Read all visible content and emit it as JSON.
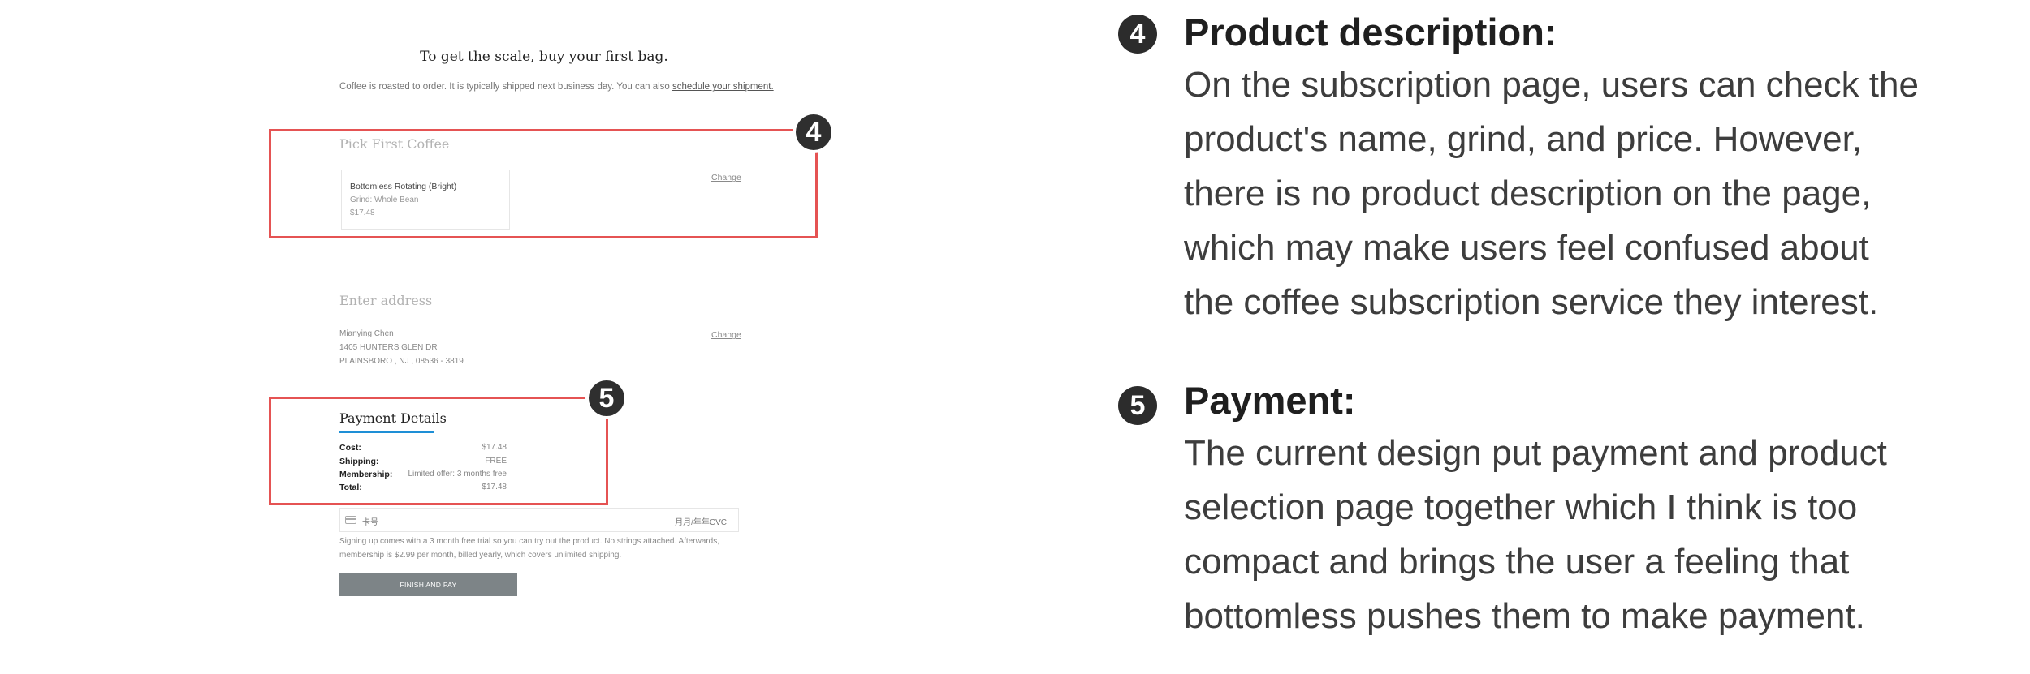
{
  "mockup": {
    "headline": "To get the scale, buy your first bag.",
    "subline_text": "Coffee is roasted to order. It is typically shipped next business day. You can also ",
    "subline_link": "schedule your shipment.",
    "pick_section": {
      "title": "Pick First Coffee",
      "change_label": "Change",
      "product_name": "Bottomless Rotating (Bright)",
      "product_grind": "Grind: Whole Bean",
      "product_price": "$17.48"
    },
    "address_section": {
      "title": "Enter address",
      "change_label": "Change",
      "lines": [
        "Mianying Chen",
        "1405 HUNTERS GLEN DR",
        "PLAINSBORO , NJ , 08536 - 3819"
      ]
    },
    "payment": {
      "title": "Payment Details",
      "rows": [
        {
          "label": "Cost:",
          "value": "$17.48"
        },
        {
          "label": "Shipping:",
          "value": "FREE"
        },
        {
          "label": "Membership:",
          "value": "Limited offer: 3 months free"
        },
        {
          "label": "Total:",
          "value": "$17.48"
        }
      ],
      "card_number_placeholder": "卡号",
      "card_expiry_placeholder": "月月/年年CVC",
      "fine_print": "Signing up comes with a 3 month free trial so you can try out the product. No strings attached. Afterwards, membership is $2.99 per month, billed yearly, which covers unlimited shipping.",
      "finish_button": "FINISH AND PAY"
    },
    "markers": {
      "four": "4",
      "five": "5"
    },
    "highlight_color": "#e55353",
    "accent_color": "#1e8fd6"
  },
  "notes": [
    {
      "number": "4",
      "title": "Product description:",
      "lines": [
        "On the subscription page, users can check the",
        "product's name, grind, and price. However,",
        "there is no product description on the page,",
        "which may make users feel confused about",
        "the coffee subscription service they interest."
      ]
    },
    {
      "number": "5",
      "title": "Payment:",
      "lines": [
        "The current design put payment and product",
        "selection page together which I think is too",
        "compact and brings the user a feeling that",
        "bottomless pushes them to make payment."
      ]
    }
  ]
}
